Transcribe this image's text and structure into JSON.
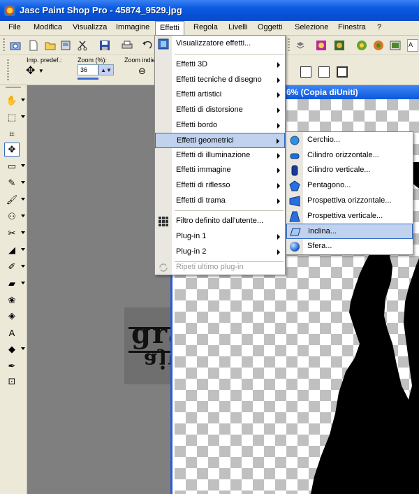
{
  "window": {
    "title": "Jasc Paint Shop Pro - 45874_9529.jpg"
  },
  "menubar": {
    "items": [
      "File",
      "Modifica",
      "Visualizza",
      "Immagine",
      "Effetti",
      "Regola",
      "Livelli",
      "Oggetti",
      "Selezione",
      "Finestra",
      "?"
    ]
  },
  "toolbar2": {
    "preset_label": "Imp. predef.:",
    "zoom_label": "Zoom (%):",
    "zoom_value": "36",
    "zoom_index_label": "Zoom indie"
  },
  "document": {
    "title_fragment": "6% (Copia diUniti)"
  },
  "watermark": {
    "line1": "grafica",
    "line2": "ajuse"
  },
  "effects_menu": {
    "items": [
      {
        "label": "Visualizzatore effetti...",
        "icon": "effects-browser-icon"
      },
      {
        "label": "Effetti 3D",
        "submenu": true
      },
      {
        "label": "Effetti tecniche d disegno",
        "submenu": true
      },
      {
        "label": "Effetti artistici",
        "submenu": true
      },
      {
        "label": "Effetti di distorsione",
        "submenu": true
      },
      {
        "label": "Effetti bordo",
        "submenu": true
      },
      {
        "label": "Effetti geometrici",
        "submenu": true,
        "highlighted": true
      },
      {
        "label": "Effetti di illuminazione",
        "submenu": true
      },
      {
        "label": "Effetti immagine",
        "submenu": true
      },
      {
        "label": "Effetti di riflesso",
        "submenu": true
      },
      {
        "label": "Effetti di trama",
        "submenu": true
      },
      {
        "label": "Filtro definito dall'utente...",
        "icon": "user-filter-icon"
      },
      {
        "label": "Plug-in 1",
        "submenu": true
      },
      {
        "label": "Plug-in 2",
        "submenu": true
      },
      {
        "label": "Ripeti ultimo plug-in",
        "disabled": true,
        "icon": "repeat-icon"
      }
    ]
  },
  "geometric_submenu": {
    "items": [
      {
        "label": "Cerchio...",
        "icon": "circle-icon"
      },
      {
        "label": "Cilindro orizzontale...",
        "icon": "horizontal-cylinder-icon"
      },
      {
        "label": "Cilindro verticale...",
        "icon": "vertical-cylinder-icon"
      },
      {
        "label": "Pentagono...",
        "icon": "pentagon-icon"
      },
      {
        "label": "Prospettiva orizzontale...",
        "icon": "horizontal-perspective-icon"
      },
      {
        "label": "Prospettiva verticale...",
        "icon": "vertical-perspective-icon"
      },
      {
        "label": "Inclina...",
        "icon": "skew-icon",
        "highlighted": true
      },
      {
        "label": "Sfera...",
        "icon": "sphere-icon"
      }
    ]
  },
  "colors": {
    "titlebar": "#0a5ae0",
    "menu_highlight": "#c1d2ee",
    "highlight_border": "#316ac5",
    "face": "#ece9d8",
    "workspace": "#7f7f7f"
  }
}
